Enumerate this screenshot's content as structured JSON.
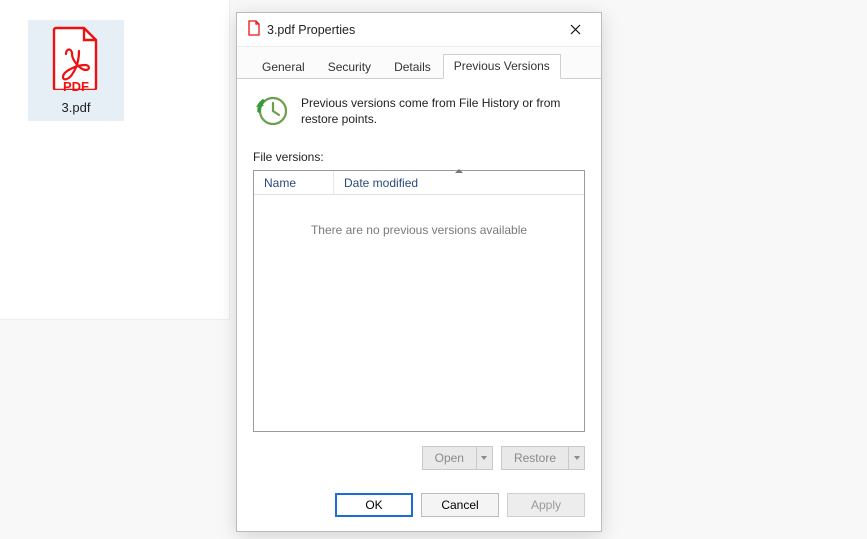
{
  "desktop": {
    "file_label": "3.pdf",
    "file_badge": "PDF"
  },
  "dialog": {
    "title": "3.pdf Properties",
    "tabs": {
      "general": "General",
      "security": "Security",
      "details": "Details",
      "previous_versions": "Previous Versions"
    },
    "info_text": "Previous versions come from File History or from restore points.",
    "section_label": "File versions:",
    "columns": {
      "name": "Name",
      "date_modified": "Date modified"
    },
    "empty_text": "There are no previous versions available",
    "buttons": {
      "open": "Open",
      "restore": "Restore",
      "ok": "OK",
      "cancel": "Cancel",
      "apply": "Apply"
    }
  }
}
